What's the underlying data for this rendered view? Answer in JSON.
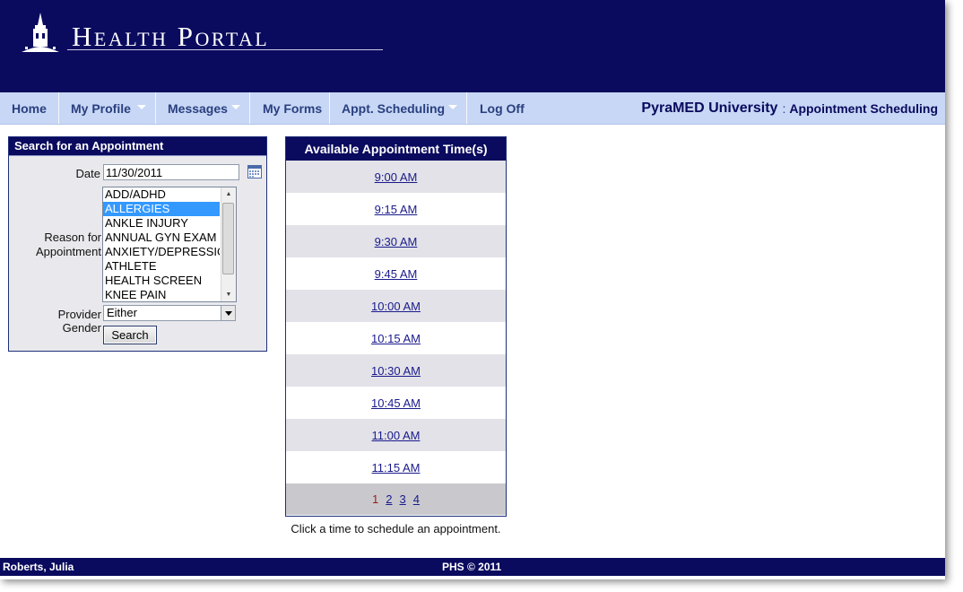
{
  "header": {
    "logo_text": "Health Portal"
  },
  "nav": {
    "items": [
      {
        "label": "Home"
      },
      {
        "label": "My Profile"
      },
      {
        "label": "Messages"
      },
      {
        "label": "My Forms"
      },
      {
        "label": "Appt. Scheduling"
      },
      {
        "label": "Log Off"
      }
    ],
    "university": "PyraMED University",
    "separator": ":",
    "page_title": "Appointment Scheduling"
  },
  "search": {
    "title": "Search for an Appointment",
    "date_label": "Date",
    "date_value": "11/30/2011",
    "reason_label_line1": "Reason for",
    "reason_label_line2": "Appointment",
    "reasons": [
      "ADD/ADHD",
      "ALLERGIES",
      "ANKLE INJURY",
      "ANNUAL GYN EXAM",
      "ANXIETY/DEPRESSIO",
      "ATHLETE",
      "HEALTH SCREEN",
      "KNEE PAIN"
    ],
    "selected_reason": "ALLERGIES",
    "gender_label": "Provider Gender",
    "gender_value": "Either",
    "search_button": "Search"
  },
  "times": {
    "title": "Available Appointment Time(s)",
    "slots": [
      "9:00 AM",
      "9:15 AM",
      "9:30 AM",
      "9:45 AM",
      "10:00 AM",
      "10:15 AM",
      "10:30 AM",
      "10:45 AM",
      "11:00 AM",
      "11:15 AM"
    ],
    "pages": [
      "1",
      "2",
      "3",
      "4"
    ],
    "current_page": "1",
    "hint": "Click a time to schedule an appointment."
  },
  "footer": {
    "user": "Roberts, Julia",
    "copyright": "PHS © 2011"
  },
  "colors": {
    "banner": "#0a0a5e",
    "nav": "#c7d7f5",
    "nav_text": "#2a3f7f",
    "selected": "#3399ff"
  }
}
